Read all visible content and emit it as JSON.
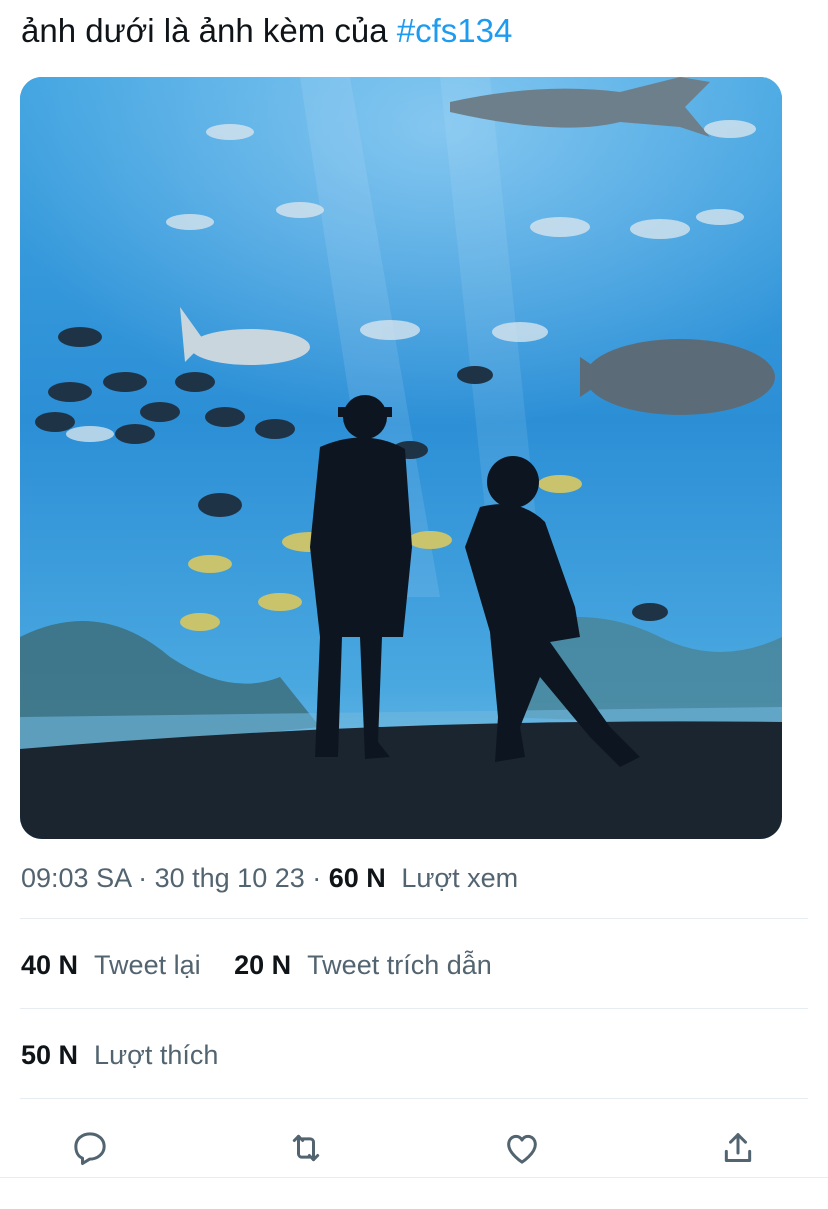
{
  "tweet": {
    "text": "ảnh dưới là ảnh kèm của ",
    "hashtag": "#cfs134"
  },
  "media": {
    "description_icon": "photo-aquarium"
  },
  "meta": {
    "time": "09:03 SA",
    "separator1": " · ",
    "date": "30 thg 10 23",
    "separator2": " · ",
    "views_count": "60 N",
    "views_label": "Lượt xem"
  },
  "stats": {
    "retweets_count": "40 N",
    "retweets_label": "Tweet lại",
    "quotes_count": "20 N",
    "quotes_label": "Tweet trích dẫn",
    "likes_count": "50 N",
    "likes_label": "Lượt thích"
  },
  "actions": [
    "reply-icon",
    "retweet-icon",
    "like-icon",
    "share-icon"
  ],
  "colors": {
    "hashtag": "#1d9bf0",
    "text": "#0f1419",
    "muted": "#536471",
    "divider": "#e6ecf0"
  }
}
